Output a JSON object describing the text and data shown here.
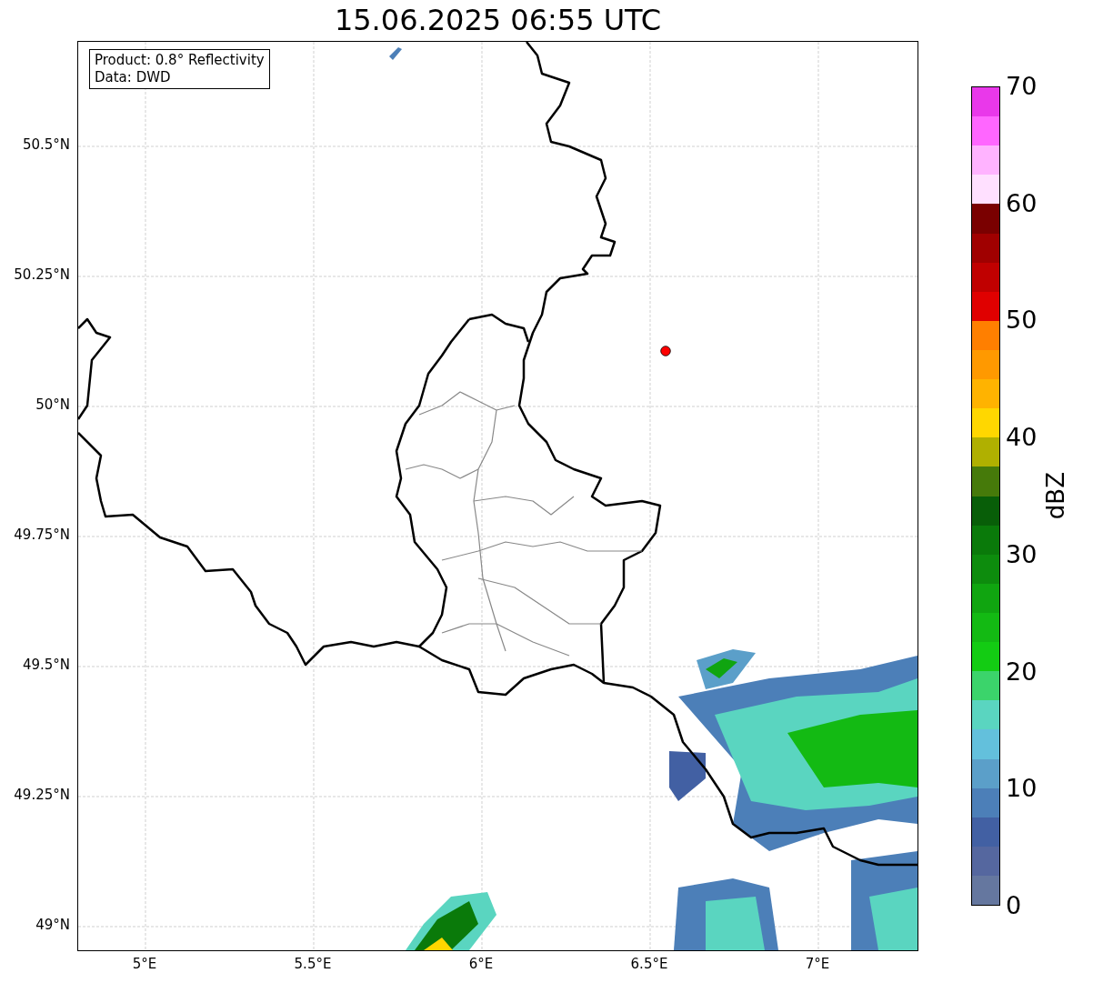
{
  "title": "15.06.2025 06:55 UTC",
  "annotation": [
    "Product: 0.8° Reflectivity",
    "Data: DWD"
  ],
  "map": {
    "yticks": [
      "50.5°N",
      "50.25°N",
      "50°N",
      "49.75°N",
      "49.5°N",
      "49.25°N",
      "49°N"
    ],
    "xticks": [
      "5°E",
      "5.5°E",
      "6°E",
      "6.5°E",
      "7°E"
    ]
  },
  "colorbar": {
    "label": "dBZ",
    "ticks": [
      "70",
      "60",
      "50",
      "40",
      "30",
      "20",
      "10",
      "0"
    ],
    "bands": [
      {
        "color": "#e938ea"
      },
      {
        "color": "#ff66ff"
      },
      {
        "color": "#ffb3ff"
      },
      {
        "color": "#ffe0ff"
      },
      {
        "color": "#7a0000"
      },
      {
        "color": "#a00000"
      },
      {
        "color": "#c00000"
      },
      {
        "color": "#e00000"
      },
      {
        "color": "#ff7f00"
      },
      {
        "color": "#ff9900"
      },
      {
        "color": "#ffb300"
      },
      {
        "color": "#ffd700"
      },
      {
        "color": "#b0b000"
      },
      {
        "color": "#467a0a"
      },
      {
        "color": "#085e08"
      },
      {
        "color": "#0a7a0a"
      },
      {
        "color": "#0d8c0d"
      },
      {
        "color": "#10a510"
      },
      {
        "color": "#13ba13"
      },
      {
        "color": "#13cc13"
      },
      {
        "color": "#3bd46b"
      },
      {
        "color": "#5ad5c0"
      },
      {
        "color": "#63c0dc"
      },
      {
        "color": "#5b9fc9"
      },
      {
        "color": "#4c7fb8"
      },
      {
        "color": "#4260a3"
      },
      {
        "color": "#55679f"
      },
      {
        "color": "#65779f"
      }
    ]
  }
}
